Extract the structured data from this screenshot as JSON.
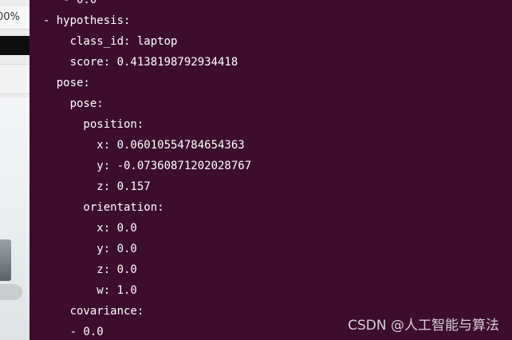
{
  "background_window": {
    "zoom_label": "00%"
  },
  "terminal": {
    "background_color": "#3d0d2e",
    "text_color": "#ffffff",
    "lines": [
      "     - 0.0",
      "  - hypothesis:",
      "      class_id: laptop",
      "      score: 0.4138198792934418",
      "    pose:",
      "      pose:",
      "        position:",
      "          x: 0.06010554784654363",
      "          y: -0.07360871202028767",
      "          z: 0.157",
      "        orientation:",
      "          x: 0.0",
      "          y: 0.0",
      "          z: 0.0",
      "          w: 1.0",
      "      covariance:",
      "      - 0.0"
    ]
  },
  "watermark": "CSDN @人工智能与算法"
}
